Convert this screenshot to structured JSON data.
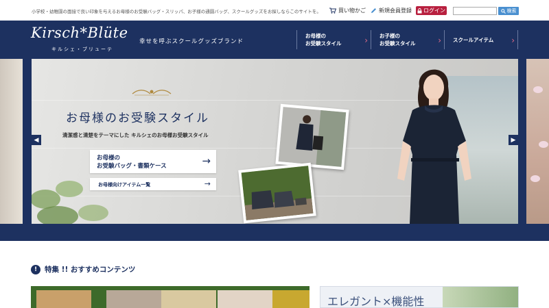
{
  "topbar": {
    "tagline": "小学校・幼稚園の面接で良い印象を与えるお母様のお受験バッグ・スリッパ、お子様の通園バッグ、スクールグッズをお探しならこのサイトを。",
    "cart_label": "買い物かご",
    "register_label": "新規会員登録",
    "login_label": "ログイン",
    "search_placeholder": "",
    "search_button": "検索"
  },
  "header": {
    "logo": "Kirsch*Blüte",
    "logo_sub": "キルシェ・ブリューテ",
    "brand_tagline": "幸せを呼ぶスクールグッズブランド",
    "nav": [
      {
        "label": "お母様の\nお受験スタイル"
      },
      {
        "label": "お子様の\nお受験スタイル"
      },
      {
        "label": "スクールアイテム"
      }
    ]
  },
  "hero": {
    "title": "お母様のお受験スタイル",
    "subtitle": "清潔感と清楚をテーマにした キルシェのお母様お受験スタイル",
    "button_primary": "お母様の\nお受験バッグ・書類ケース",
    "button_secondary": "お母様向けアイテム一覧",
    "prev_icon": "chevron-left",
    "next_icon": "chevron-right"
  },
  "featured": {
    "icon": "exclamation",
    "title": "特集 !! おすすめコンテンツ",
    "card2_text": "エレガント×機能性"
  },
  "colors": {
    "navy": "#1d3160",
    "login_red": "#b8203f",
    "search_blue": "#4a90d0",
    "nav_arrow_pink": "#e06a88"
  }
}
